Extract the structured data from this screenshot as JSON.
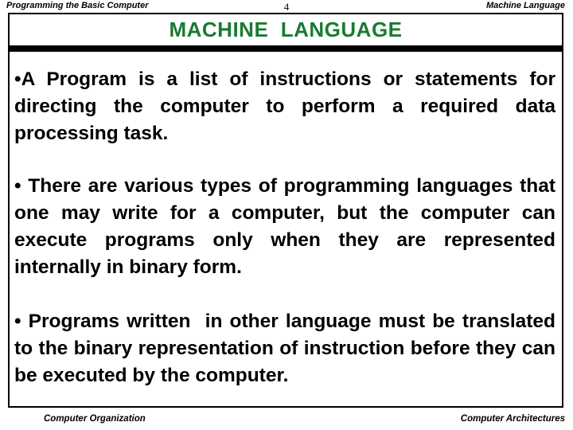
{
  "slide": {
    "page_number": "4",
    "header": {
      "left_text": "Programming the Basic Computer",
      "right_text": "Machine Language"
    },
    "title": "MACHINE  LANGUAGE",
    "title_color": "#1a7a33",
    "divider_color": "#000000",
    "border_color": "#000000",
    "background_color": "#ffffff",
    "body": {
      "bullets": [
        "•A Program is a list of instructions or statements for directing the computer to perform a required data processing task.",
        "• There are various types of programming languages that one may write for a computer, but the computer can execute programs only when they are represented internally in binary form.",
        "• Programs written  in other language must be translated to the binary representation of instruction before they can be executed by the computer."
      ]
    },
    "footer": {
      "left_text": "Computer Organization",
      "right_text": "Computer Architectures"
    }
  }
}
